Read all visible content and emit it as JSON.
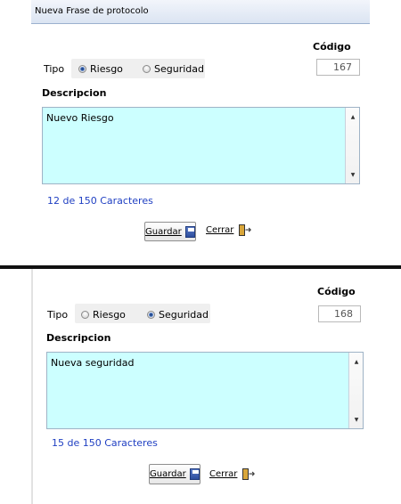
{
  "window": {
    "title": "Nueva Frase de protocolo"
  },
  "forms": [
    {
      "codigo_label": "Código",
      "codigo_value": "167",
      "tipo_label": "Tipo",
      "radio_riesgo_label": "Riesgo",
      "radio_seguridad_label": "Seguridad",
      "selected": "Riesgo",
      "descripcion_label": "Descripcion",
      "descripcion_text": "Nuevo Riesgo",
      "counter": "12 de 150 Caracteres",
      "guardar_label": "Guardar",
      "cerrar_label": "Cerrar"
    },
    {
      "codigo_label": "Código",
      "codigo_value": "168",
      "tipo_label": "Tipo",
      "radio_riesgo_label": "Riesgo",
      "radio_seguridad_label": "Seguridad",
      "selected": "Seguridad",
      "descripcion_label": "Descripcion",
      "descripcion_text": "Nueva seguridad",
      "counter": "15 de 150 Caracteres",
      "guardar_label": "Guardar",
      "cerrar_label": "Cerrar"
    }
  ],
  "icons": {
    "save": "save-disk-icon",
    "close": "door-exit-icon",
    "scroll_up": "scroll-up-arrow-icon",
    "scroll_down": "scroll-down-arrow-icon"
  }
}
